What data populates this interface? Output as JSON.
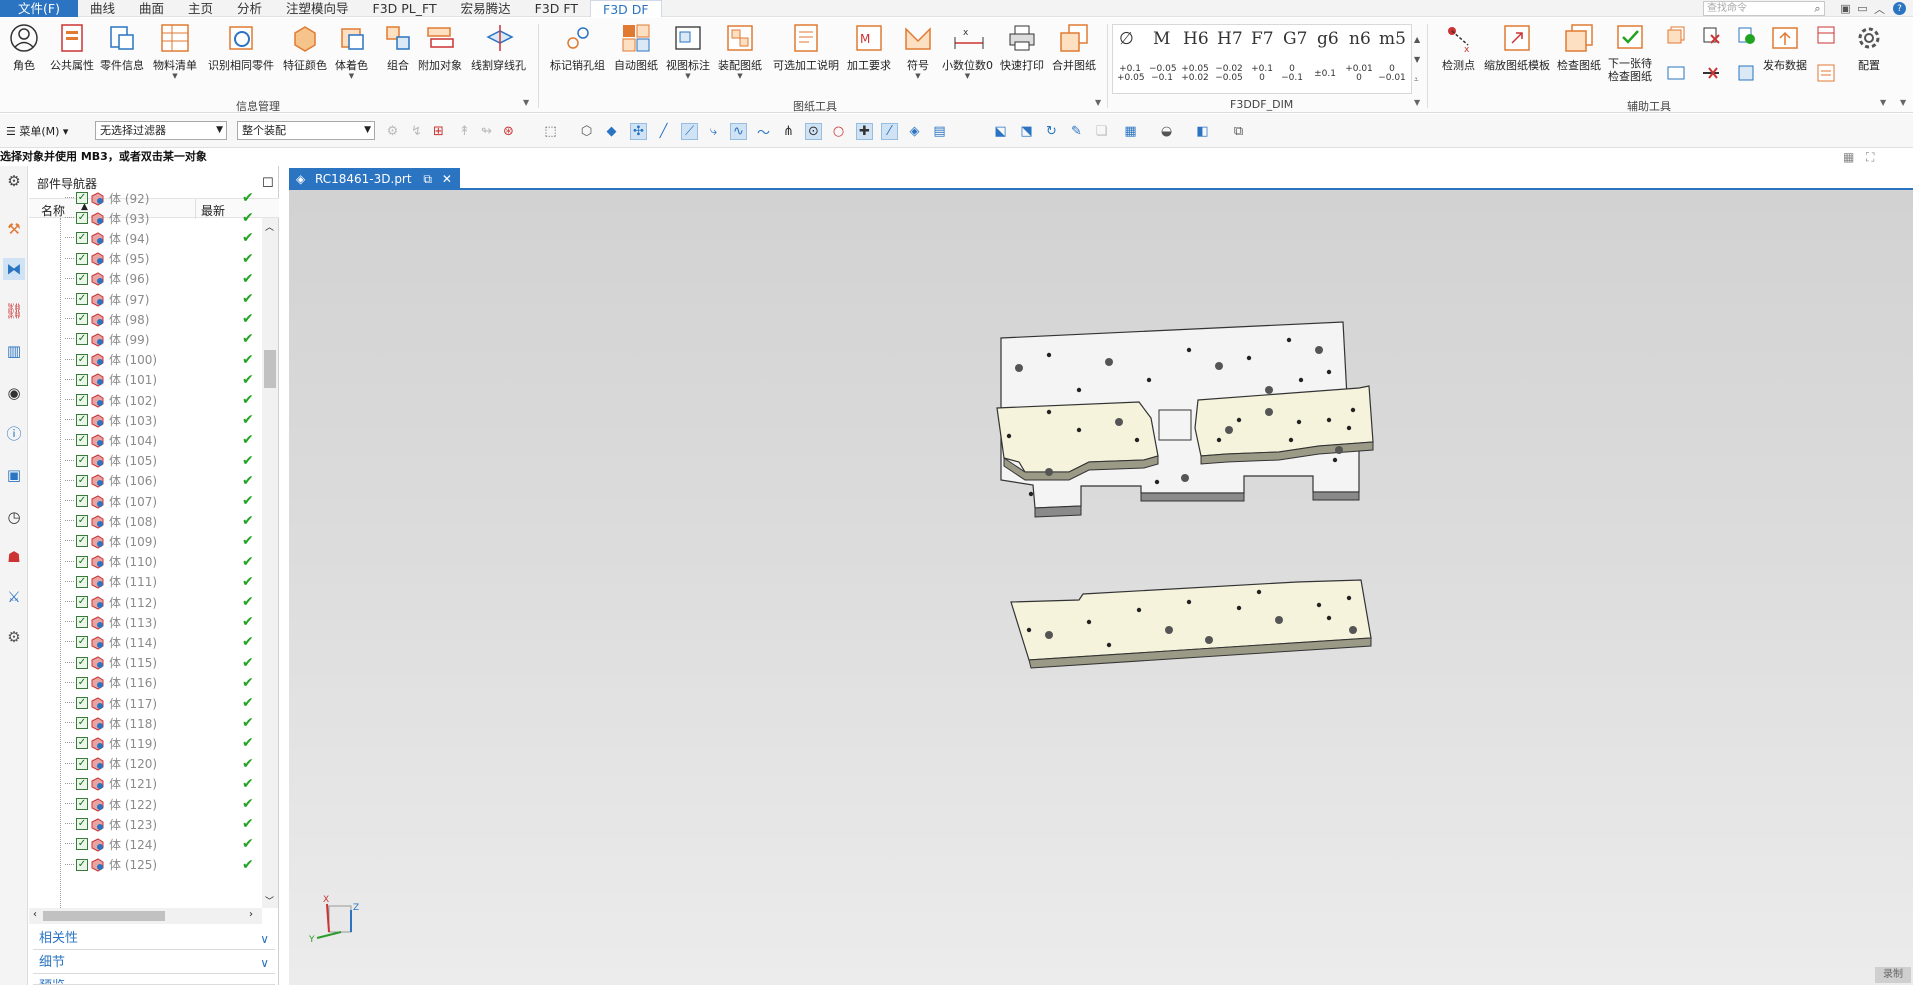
{
  "menubar": {
    "tabs": [
      "文件(F)",
      "曲线",
      "曲面",
      "主页",
      "分析",
      "注塑模向导",
      "F3D PL_FT",
      "宏易腾达",
      "F3D FT",
      "F3D DF"
    ],
    "active_tab": "F3D DF",
    "search_placeholder": "查找命令"
  },
  "ribbon": {
    "group1": {
      "name": "信息管理",
      "buttons": [
        "角色",
        "公共属性",
        "零件信息",
        "物料清单",
        "识别相同零件",
        "特征颜色",
        "体着色",
        "组合",
        "附加对象",
        "线割穿线孔"
      ]
    },
    "group2": {
      "name": "图纸工具",
      "buttons": [
        "标记销孔组",
        "自动图纸",
        "视图标注",
        "装配图纸",
        "可选加工说明",
        "加工要求",
        "符号",
        "小数位数0",
        "快速打印",
        "合并图纸"
      ]
    },
    "group3": {
      "name": "F3DDF_DIM",
      "symbols": [
        "∅",
        "M",
        "H6",
        "H7",
        "F7",
        "G7",
        "g6",
        "n6",
        "m5"
      ],
      "tolerances": [
        "+0.1\n+0.05",
        "−0.05\n−0.1",
        "+0.05\n+0.02",
        "−0.02\n−0.05",
        "+0.1\n0",
        "0\n−0.1",
        "±0.1",
        "+0.01\n0",
        "0\n−0.01"
      ]
    },
    "group4": {
      "name": "辅助工具",
      "buttons": [
        "检测点",
        "缩放图纸模板",
        "检查图纸",
        "下一张待\n检查图纸",
        "发布数据",
        "配置"
      ]
    }
  },
  "toolbar2": {
    "menu_label": "菜单(M)",
    "filter_value": "无选择过滤器",
    "scope_value": "整个装配"
  },
  "hint": "选择对象并使用 MB3，或者双击某一对象",
  "navigator": {
    "title": "部件导航器",
    "col_name": "名称",
    "col_latest": "最新",
    "rows": [
      "体 (92)",
      "体 (93)",
      "体 (94)",
      "体 (95)",
      "体 (96)",
      "体 (97)",
      "体 (98)",
      "体 (99)",
      "体 (100)",
      "体 (101)",
      "体 (102)",
      "体 (103)",
      "体 (104)",
      "体 (105)",
      "体 (106)",
      "体 (107)",
      "体 (108)",
      "体 (109)",
      "体 (110)",
      "体 (111)",
      "体 (112)",
      "体 (113)",
      "体 (114)",
      "体 (115)",
      "体 (116)",
      "体 (117)",
      "体 (118)",
      "体 (119)",
      "体 (120)",
      "体 (121)",
      "体 (122)",
      "体 (123)",
      "体 (124)",
      "体 (125)"
    ],
    "panels": [
      "相关性",
      "细节",
      "预览"
    ]
  },
  "document": {
    "tab_title": "RC18461-3D.prt"
  },
  "statusbar": {
    "record": "录制"
  },
  "colors": {
    "accent": "#2a74c2",
    "plate_cream": "#f5f3dc",
    "plate_white": "#f4f4f4",
    "check_green": "#22a322"
  }
}
